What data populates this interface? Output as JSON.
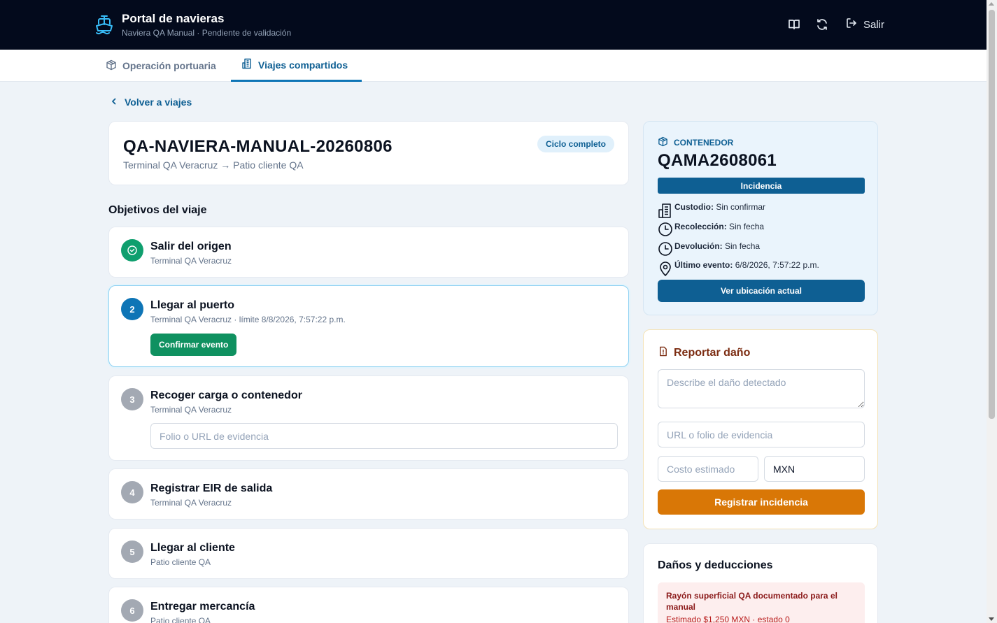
{
  "header": {
    "title": "Portal de navieras",
    "subtitle": "Naviera QA Manual · Pendiente de validación",
    "logout_label": "Salir",
    "icons": [
      "ship-icon",
      "book-icon",
      "refresh-icon",
      "logout-icon"
    ]
  },
  "tabs": [
    {
      "label": "Operación portuaria",
      "icon": "box-icon",
      "active": false
    },
    {
      "label": "Viajes compartidos",
      "icon": "building-icon",
      "active": true
    }
  ],
  "back_label": "Volver a viajes",
  "trip": {
    "id": "QA-NAVIERA-MANUAL-20260806",
    "route": "Terminal QA Veracruz → Patio cliente QA",
    "status_badge": "Ciclo completo"
  },
  "objectives": {
    "title": "Objetivos del viaje",
    "steps": [
      {
        "number": "✓",
        "title": "Salir del origen",
        "subtitle": "Terminal QA Veracruz",
        "state": "done"
      },
      {
        "number": "2",
        "title": "Llegar al puerto",
        "subtitle": "Terminal QA Veracruz · límite 8/8/2026, 7:57:22 p.m.",
        "state": "current",
        "action": "Confirmar evento"
      },
      {
        "number": "3",
        "title": "Recoger carga o contenedor",
        "subtitle": "Terminal QA Veracruz",
        "state": "pending",
        "input_placeholder": "Folio o URL de evidencia"
      },
      {
        "number": "4",
        "title": "Registrar EIR de salida",
        "subtitle": "Terminal QA Veracruz",
        "state": "pending"
      },
      {
        "number": "5",
        "title": "Llegar al cliente",
        "subtitle": "Patio cliente QA",
        "state": "pending"
      },
      {
        "number": "6",
        "title": "Entregar mercancía",
        "subtitle": "Patio cliente QA",
        "state": "pending"
      }
    ]
  },
  "container": {
    "label": "CONTENEDOR",
    "id": "QAMA2608061",
    "status": "Incidencia",
    "custodio_label": "Custodio:",
    "custodio_value": "Sin confirmar",
    "recoleccion_label": "Recolección:",
    "recoleccion_value": "Sin fecha",
    "devolucion_label": "Devolución:",
    "devolucion_value": "Sin fecha",
    "ultimo_label": "Último evento:",
    "ultimo_value": "6/8/2026, 7:57:22 p.m.",
    "location_button": "Ver ubicación actual"
  },
  "damage": {
    "title": "Reportar daño",
    "description_placeholder": "Describe el daño detectado",
    "evidence_placeholder": "URL o folio de evidencia",
    "cost_placeholder": "Costo estimado",
    "currency_value": "MXN",
    "submit_label": "Registrar incidencia"
  },
  "deductions": {
    "title": "Daños y deducciones",
    "items": [
      {
        "title": "Rayón superficial QA documentado para el manual",
        "detail": "Estimado $1,250 MXN · estado 0"
      }
    ]
  },
  "colors": {
    "header_bg": "#030a1c",
    "primary": "#0e5f93",
    "success": "#0f9160",
    "warning": "#d97706",
    "danger_bg": "#fdeeee"
  }
}
